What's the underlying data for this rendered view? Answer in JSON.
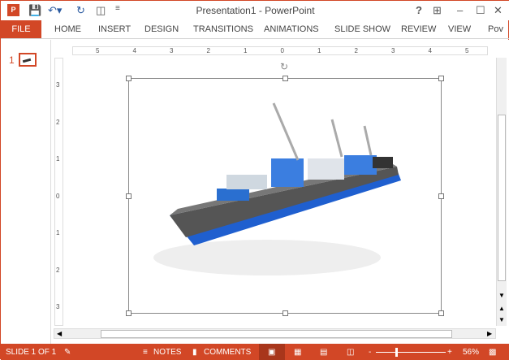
{
  "window": {
    "title": "Presentation1 - PowerPoint",
    "help": "?",
    "controls": [
      "ribbon-display",
      "minimize",
      "maximize",
      "close"
    ]
  },
  "tabs": [
    "FILE",
    "HOME",
    "INSERT",
    "DESIGN",
    "TRANSITIONS",
    "ANIMATIONS",
    "SLIDE SHOW",
    "REVIEW",
    "VIEW",
    "Pov"
  ],
  "thumbnail": {
    "number": "1"
  },
  "ruler": {
    "h": [
      "5",
      "4",
      "3",
      "2",
      "1",
      "0",
      "1",
      "2",
      "3",
      "4",
      "5"
    ],
    "v": [
      "3",
      "2",
      "1",
      "0",
      "1",
      "2",
      "3"
    ]
  },
  "status": {
    "slide": "SLIDE 1 OF 1",
    "notes": "NOTES",
    "comments": "COMMENTS",
    "zoom_minus": "-",
    "zoom_plus": "+",
    "zoom": "56%",
    "zoom_level_fraction": 0.56
  },
  "colors": {
    "accent": "#d24726"
  }
}
